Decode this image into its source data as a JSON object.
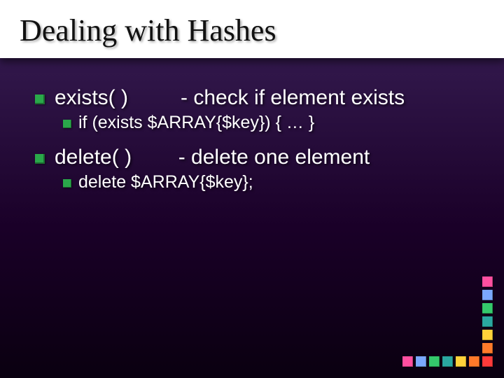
{
  "title": "Dealing with Hashes",
  "items": [
    {
      "text": "exists( )         - check if element exists",
      "sub": [
        {
          "text": "if (exists $ARRAY{$key}) { … }"
        }
      ]
    },
    {
      "text": "delete( )        - delete one element",
      "sub": [
        {
          "text": "delete $ARRAY{$key};"
        }
      ]
    }
  ],
  "deco_colors_vertical": [
    "#ff4fa0",
    "#7aa8ff",
    "#34c96b",
    "#2aa8a0",
    "#ffd23a",
    "#ff7a2a",
    "#ff3a3a"
  ],
  "deco_colors_horizontal": [
    "#ff4fa0",
    "#7aa8ff",
    "#34c96b",
    "#2aa8a0",
    "#ffd23a",
    "#ff7a2a"
  ]
}
